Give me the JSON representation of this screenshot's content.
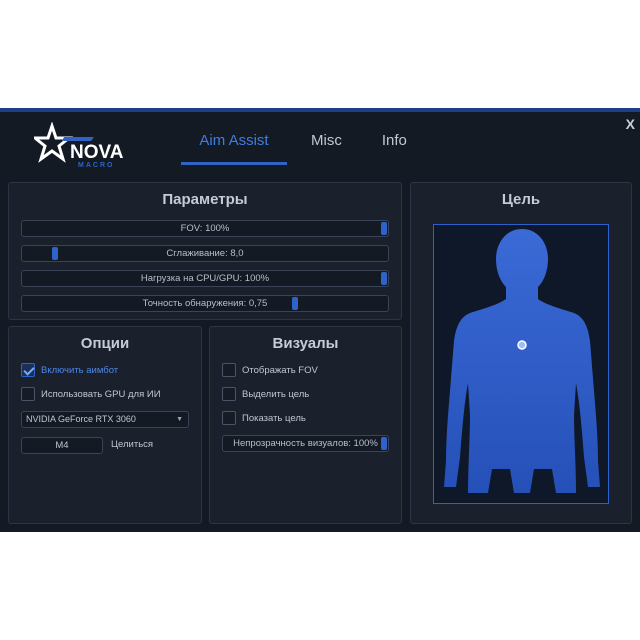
{
  "window": {
    "close_label": "X"
  },
  "logo": {
    "name": "NOVA",
    "sub": "MACRO"
  },
  "tabs": [
    {
      "label": "Aim Assist",
      "active": true
    },
    {
      "label": "Misc",
      "active": false
    },
    {
      "label": "Info",
      "active": false
    }
  ],
  "params": {
    "title": "Параметры",
    "sliders": [
      {
        "label": "FOV: 100%",
        "value": 1.0
      },
      {
        "label": "Сглаживание: 8,0",
        "value": 0.08
      },
      {
        "label": "Нагрузка на CPU/GPU: 100%",
        "value": 1.0
      },
      {
        "label": "Точность обнаружения: 0,75",
        "value": 0.75
      }
    ]
  },
  "options": {
    "title": "Опции",
    "aimbot_label": "Включить аимбот",
    "aimbot_checked": true,
    "gpu_label": "Использовать GPU для ИИ",
    "gpu_checked": false,
    "gpu_select_value": "NVIDIA GeForce RTX 3060",
    "key_value": "M4",
    "key_label": "Целиться"
  },
  "visuals": {
    "title": "Визуалы",
    "checks": [
      {
        "label": "Отображать FOV",
        "checked": false
      },
      {
        "label": "Выделить цель",
        "checked": false
      },
      {
        "label": "Показать цель",
        "checked": false
      }
    ],
    "opacity_label": "Непрозрачность визуалов: 100%",
    "opacity_value": 1.0
  },
  "target": {
    "title": "Цель"
  },
  "colors": {
    "accent": "#2e63c9",
    "tab_active": "#3f7ce0",
    "body_fill": "#2a58c4",
    "background": "#141a24"
  }
}
